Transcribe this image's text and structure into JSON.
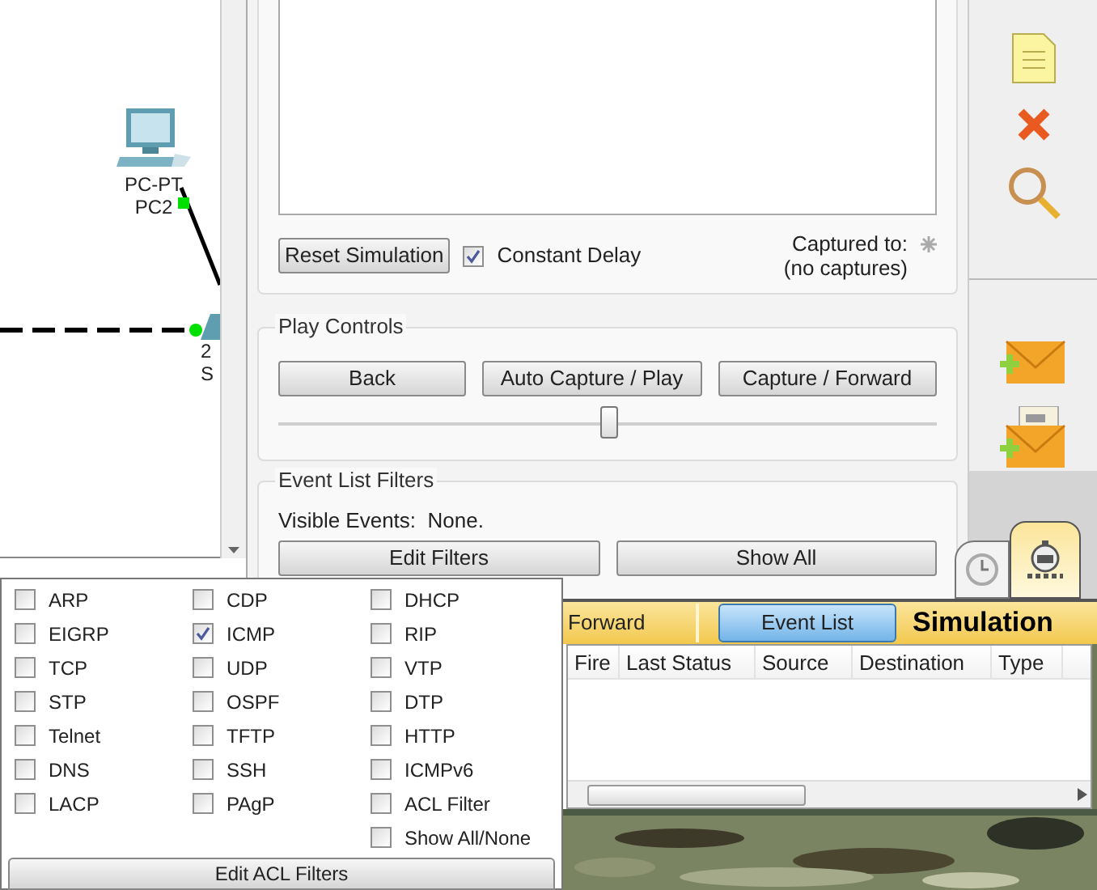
{
  "canvas": {
    "nodes": [
      {
        "kind": "pc",
        "model": "PC-PT",
        "name": "PC2"
      },
      {
        "kind": "switch",
        "model": "2",
        "name": "S"
      }
    ]
  },
  "capture": {
    "reset_button": "Reset Simulation",
    "constant_delay": {
      "label": "Constant Delay",
      "checked": true
    },
    "captured_label": "Captured to:",
    "captured_value": "(no captures)"
  },
  "play_controls": {
    "title": "Play Controls",
    "buttons": [
      "Back",
      "Auto Capture / Play",
      "Capture / Forward"
    ],
    "speed": {
      "level": 0.5
    }
  },
  "event_list_filters": {
    "title": "Event List Filters",
    "visible_events": "Visible Events:  None.",
    "buttons": [
      "Edit Filters",
      "Show All"
    ]
  },
  "mode_bar": {
    "tabs": [
      {
        "label": "Forward",
        "selected": false
      },
      {
        "label": "Event List",
        "selected": true
      }
    ],
    "mode": "Simulation"
  },
  "event_table": {
    "columns": [
      "Fire",
      "Last Status",
      "Source",
      "Destination",
      "Type"
    ]
  },
  "filter_popup": {
    "columns": [
      [
        {
          "label": "ARP",
          "checked": false
        },
        {
          "label": "EIGRP",
          "checked": false
        },
        {
          "label": "TCP",
          "checked": false
        },
        {
          "label": "STP",
          "checked": false
        },
        {
          "label": "Telnet",
          "checked": false
        },
        {
          "label": "DNS",
          "checked": false
        },
        {
          "label": "LACP",
          "checked": false
        }
      ],
      [
        {
          "label": "CDP",
          "checked": false
        },
        {
          "label": "ICMP",
          "checked": true
        },
        {
          "label": "UDP",
          "checked": false
        },
        {
          "label": "OSPF",
          "checked": false
        },
        {
          "label": "TFTP",
          "checked": false
        },
        {
          "label": "SSH",
          "checked": false
        },
        {
          "label": "PAgP",
          "checked": false
        }
      ],
      [
        {
          "label": "DHCP",
          "checked": false
        },
        {
          "label": "RIP",
          "checked": false
        },
        {
          "label": "VTP",
          "checked": false
        },
        {
          "label": "DTP",
          "checked": false
        },
        {
          "label": "HTTP",
          "checked": false
        },
        {
          "label": "ICMPv6",
          "checked": false
        },
        {
          "label": "ACL Filter",
          "checked": false
        },
        {
          "label": "Show All/None",
          "checked": false
        }
      ]
    ],
    "button": "Edit ACL Filters"
  }
}
